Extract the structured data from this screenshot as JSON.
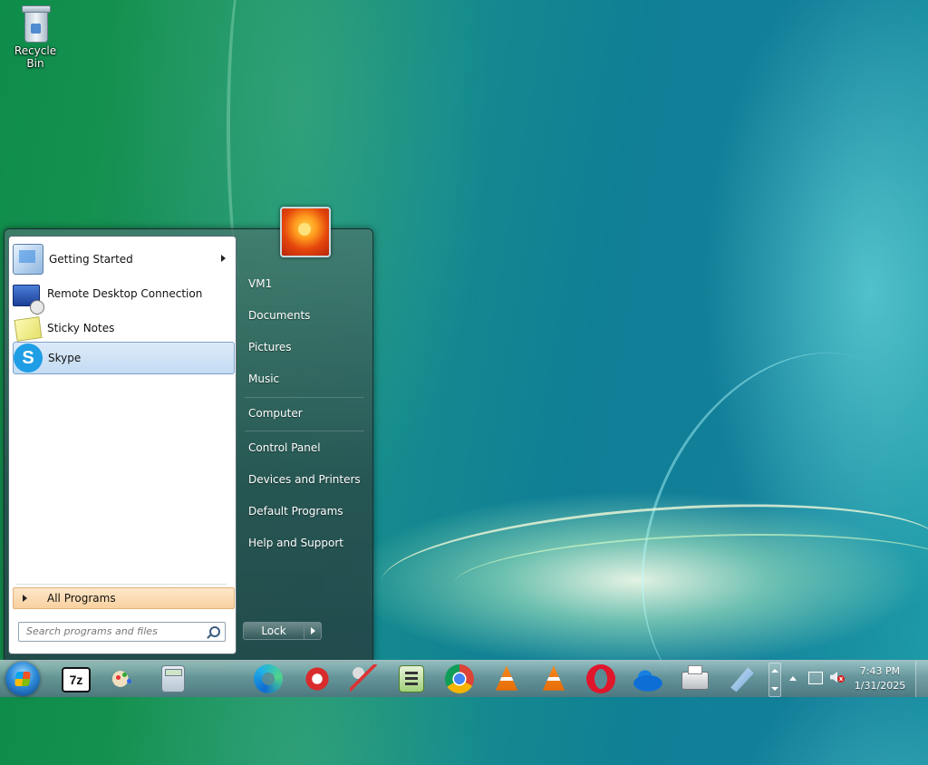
{
  "desktop": {
    "icons": [
      {
        "label": "Recycle Bin",
        "icon": "recycle-bin-icon"
      }
    ]
  },
  "start_menu": {
    "pinned_programs": [
      {
        "label": "Getting Started",
        "icon": "getting-started-icon",
        "has_submenu": true
      },
      {
        "label": "Remote Desktop Connection",
        "icon": "remote-desktop-icon"
      },
      {
        "label": "Sticky Notes",
        "icon": "sticky-notes-icon"
      },
      {
        "label": "Skype",
        "icon": "skype-icon",
        "selected": true
      }
    ],
    "all_programs_label": "All Programs",
    "search_placeholder": "Search programs and files",
    "right_links": [
      "VM1",
      "Documents",
      "Pictures",
      "Music",
      "Computer",
      "Control Panel",
      "Devices and Printers",
      "Default Programs",
      "Help and Support"
    ],
    "lock_button_label": "Lock"
  },
  "taskbar": {
    "start_button_icon": "windows-orb-icon",
    "pinned_icons": [
      "7zip-icon",
      "paint-icon",
      "calculator-icon",
      "edge-icon",
      "ccleaner-icon",
      "snipping-tool-icon",
      "notepad-plus-plus-icon",
      "chrome-icon",
      "vlc-icon",
      "vlc-icon-2",
      "opera-icon",
      "onedrive-icon",
      "printer-icon",
      "tool-icon"
    ],
    "ic_7z_text": "7z",
    "clock": {
      "time": "7:43 PM",
      "date": "1/31/2025"
    }
  },
  "colors": {
    "selection_bg": "#c4dcf4",
    "all_programs_bg": "#f9d1a0",
    "accent_skype": "#1f9ee6"
  }
}
